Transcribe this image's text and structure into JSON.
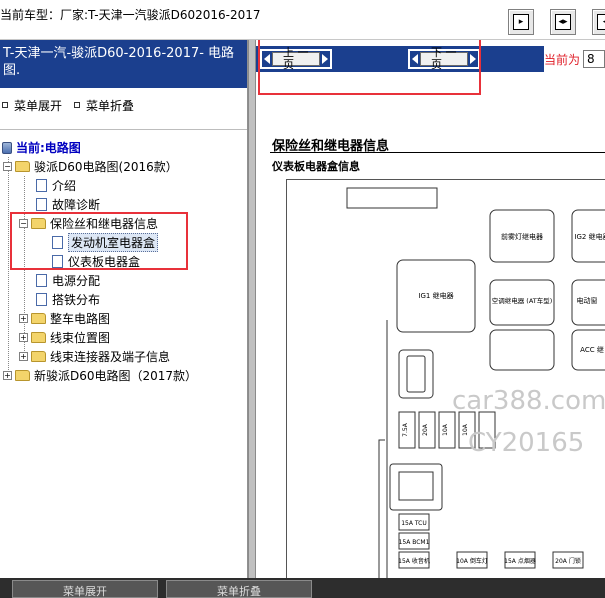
{
  "header": {
    "title": "当前车型：厂家:T-天津一汽骏派D602016-2017"
  },
  "sidebar": {
    "heading": "T-天津一汽-骏派D60-2016-2017- 电路图.",
    "menu_expand": "菜单展开",
    "menu_collapse": "菜单折叠",
    "current_label": "当前:电路图",
    "tree": [
      {
        "label": "骏派D60电路图(2016款）",
        "type": "folder",
        "level": 0,
        "toggle": "−"
      },
      {
        "label": "介绍",
        "type": "doc",
        "level": 1
      },
      {
        "label": "故障诊断",
        "type": "doc",
        "level": 1
      },
      {
        "label": "保险丝和继电器信息",
        "type": "folder",
        "level": 1,
        "toggle": "−"
      },
      {
        "label": "发动机室电器盒",
        "type": "doc",
        "level": 2,
        "selected": true
      },
      {
        "label": "仪表板电器盒",
        "type": "doc",
        "level": 2
      },
      {
        "label": "电源分配",
        "type": "doc",
        "level": 1
      },
      {
        "label": "搭铁分布",
        "type": "doc",
        "level": 1
      },
      {
        "label": "整车电路图",
        "type": "folder",
        "level": 1,
        "toggle": "+"
      },
      {
        "label": "线束位置图",
        "type": "folder",
        "level": 1,
        "toggle": "+"
      },
      {
        "label": "线束连接器及端子信息",
        "type": "folder",
        "level": 1,
        "toggle": "+"
      },
      {
        "label": "新骏派D60电路图（2017款）",
        "type": "folder",
        "level": 0,
        "toggle": "+"
      }
    ]
  },
  "pager": {
    "prev_label": "上 一 页",
    "next_label": "下 一 页",
    "current_label": "当前为",
    "current_value": "8"
  },
  "document": {
    "title": "保险丝和继电器信息",
    "subtitle": "仪表板电器盒信息",
    "diagram_labels": {
      "relay_front_fog": "前雾灯继电器",
      "relay_ig2": "IG2 继电器",
      "relay_ig1": "IG1 继电器",
      "relay_ac": "空调继电器\n(AT车型)",
      "relay_electric": "电动窗",
      "relay_acc": "ACC 继",
      "fuse_75a": "7.5A",
      "fuse_20a": "20A",
      "fuse_10a_1": "10A",
      "fuse_10a_2": "10A",
      "fuse_tcu": "15A\nTCU",
      "fuse_bcm1": "15A\nBCM1",
      "fuse_radio": "15A\n收音机",
      "fuse_reverse": "10A\n倒车灯",
      "fuse_cigar": "15A\n点烟器",
      "fuse_door": "20A\n门锁"
    }
  },
  "watermark": {
    "line1": "car388.com",
    "line2": "CY20165"
  },
  "footer": {
    "expand_btn": "菜单展开",
    "collapse_btn": "菜单折叠"
  },
  "colors": {
    "header_blue": "#1b3f8e",
    "highlight_red": "#e8313a",
    "current_text": "#0000c0"
  }
}
